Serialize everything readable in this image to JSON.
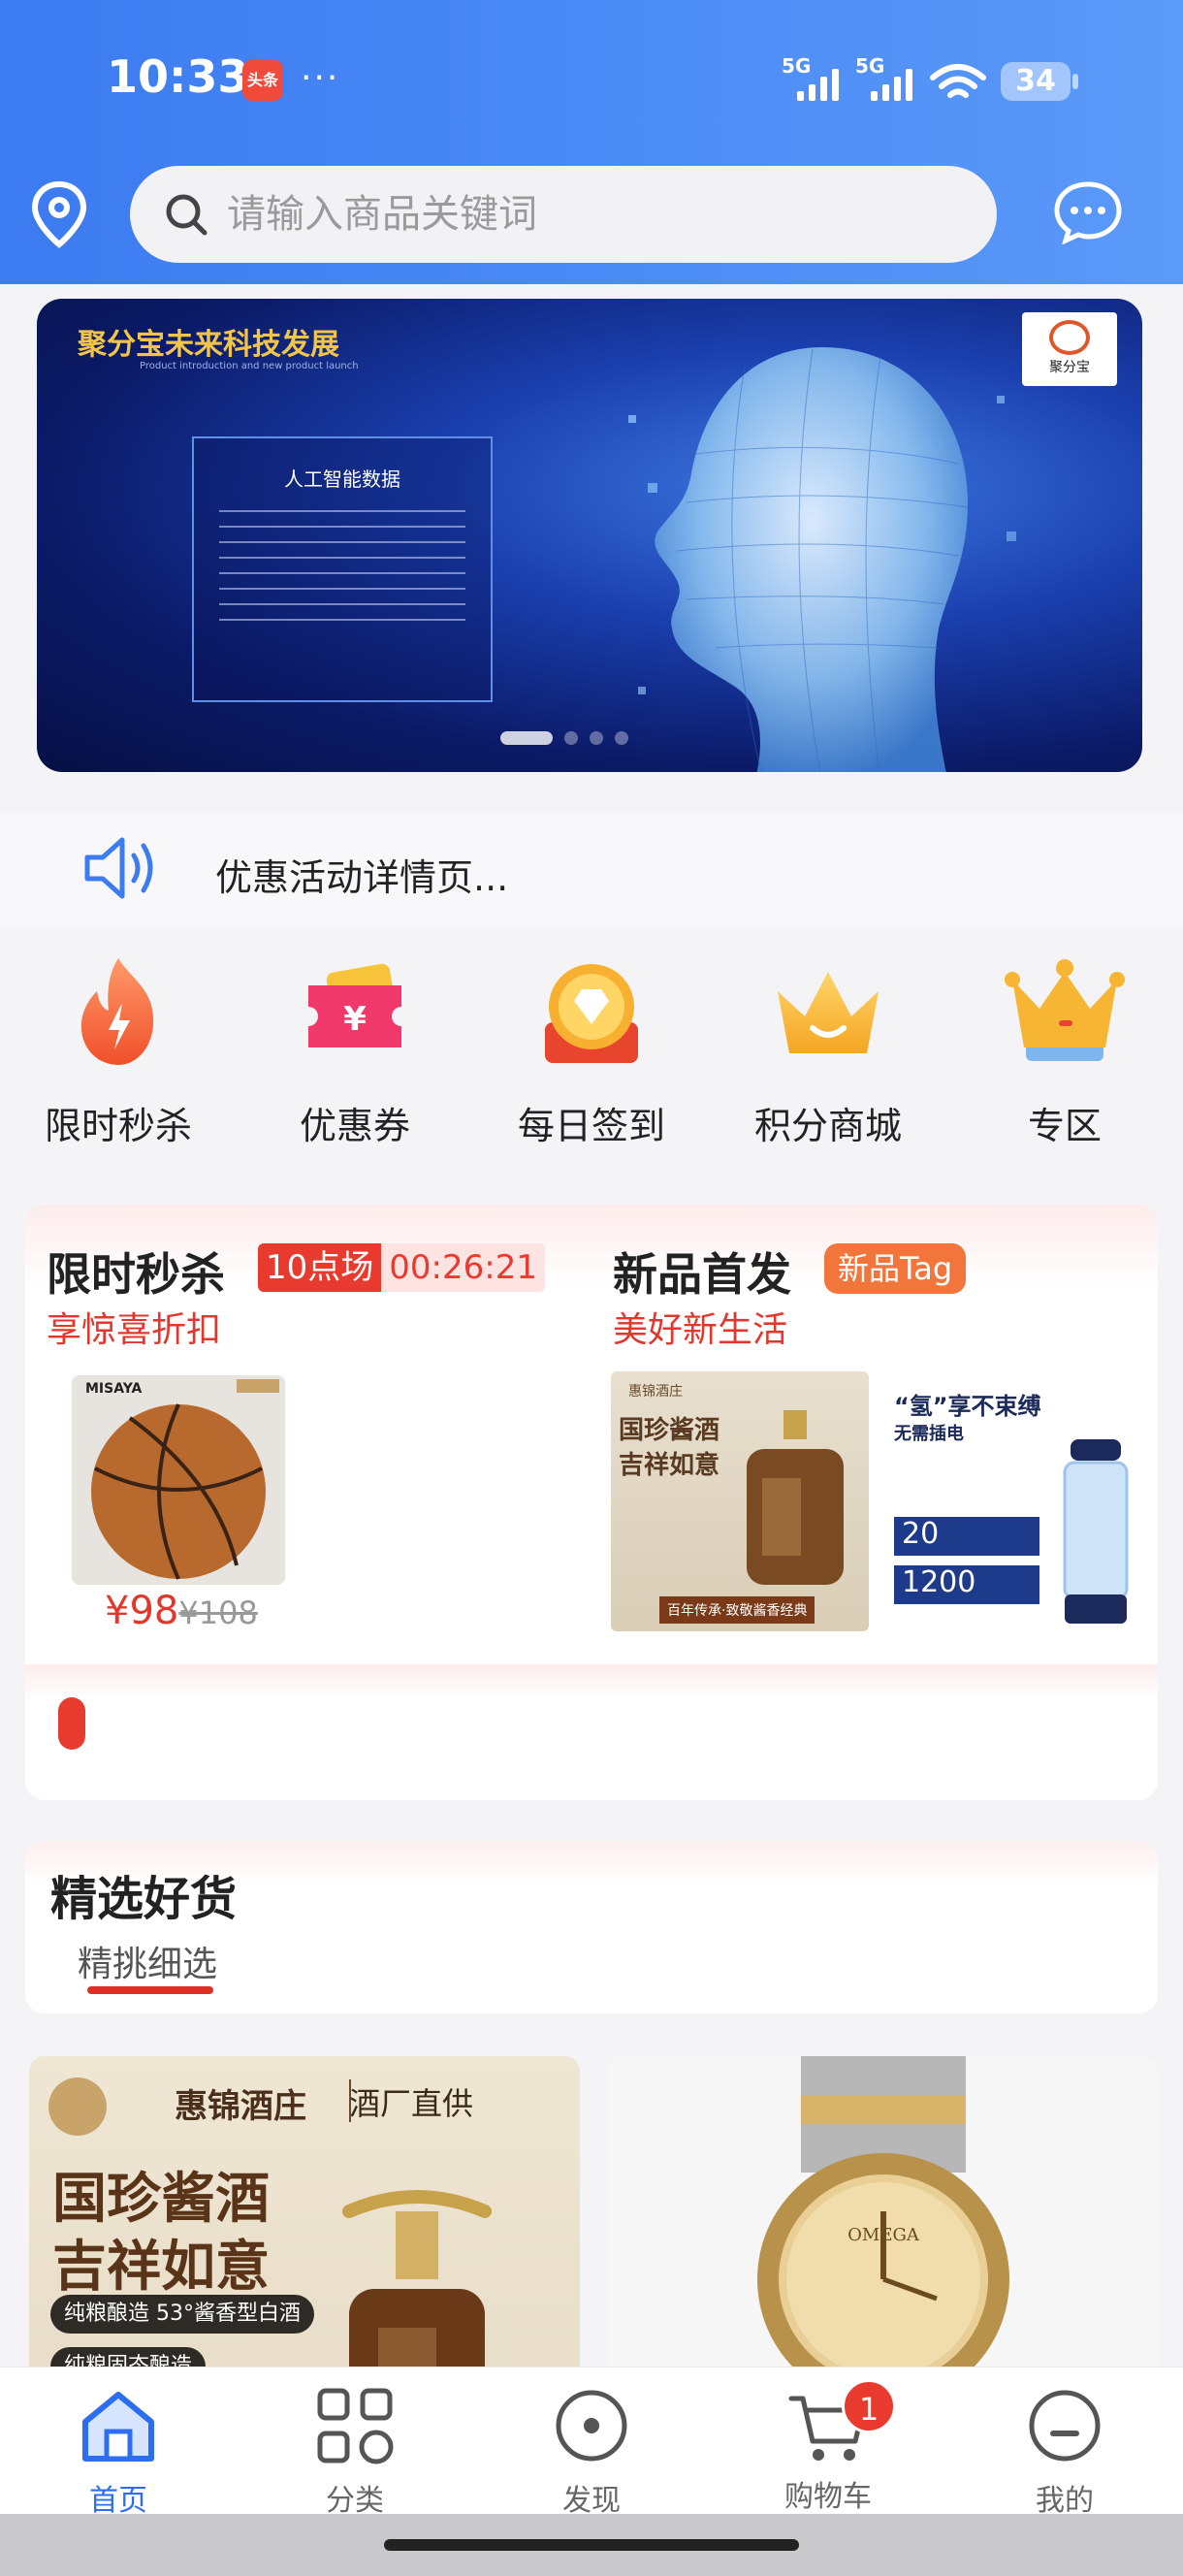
{
  "status_bar": {
    "time": "10:33",
    "app_badge": "头条",
    "more": "···",
    "signal1": "5G",
    "signal2": "5G",
    "battery": "34"
  },
  "search": {
    "placeholder": "请输入商品关键词"
  },
  "banner": {
    "title": "聚分宝未来科技发展",
    "subtitle": "Product introduction and new product launch",
    "box_title": "人工智能数据",
    "logo_text": "聚分宝"
  },
  "notice": {
    "text": "优惠活动详情页..."
  },
  "quick_menu": [
    {
      "label": "限时秒杀",
      "icon": "flame-icon"
    },
    {
      "label": "优惠券",
      "icon": "coupon-icon"
    },
    {
      "label": "每日签到",
      "icon": "diamond-icon"
    },
    {
      "label": "积分商城",
      "icon": "crown-icon"
    },
    {
      "label": "专区",
      "icon": "king-crown-icon"
    }
  ],
  "flash_sale": {
    "title": "限时秒杀",
    "slot": "10点场",
    "countdown": "00:26:21",
    "subtitle": "享惊喜折扣",
    "product": {
      "brand": "MISAYA",
      "price": "¥98",
      "original_price": "¥108"
    }
  },
  "new_arrivals": {
    "title": "新品首发",
    "tag": "新品Tag",
    "subtitle": "美好新生活",
    "product1": {
      "brand": "惠锦酒庄",
      "headline1": "国珍酱酒",
      "headline2": "吉祥如意",
      "banner_text": "百年传承·致敬酱香经典"
    },
    "product2": {
      "headline": "“氢”享不束缚",
      "sub": "无需插电",
      "stat1": "20",
      "stat2": "1200"
    }
  },
  "selected": {
    "title": "精选好货",
    "tab": "精挑细选"
  },
  "products": [
    {
      "brand": "惠锦酒庄",
      "label": "酒厂直供",
      "headline1": "国珍酱酒",
      "headline2": "吉祥如意",
      "desc": "纯粮酿造 53°酱香型白酒",
      "desc2": "纯粮固态酿造"
    },
    {
      "brand": "OMEGA"
    }
  ],
  "bottom_nav": [
    {
      "label": "首页",
      "icon": "home-icon",
      "active": true
    },
    {
      "label": "分类",
      "icon": "category-icon"
    },
    {
      "label": "发现",
      "icon": "discover-icon"
    },
    {
      "label": "购物车",
      "icon": "cart-icon",
      "badge": "1"
    },
    {
      "label": "我的",
      "icon": "profile-icon"
    }
  ],
  "colors": {
    "primary": "#3c7bf0",
    "accent_red": "#e83a2e",
    "orange": "#f2763c"
  }
}
